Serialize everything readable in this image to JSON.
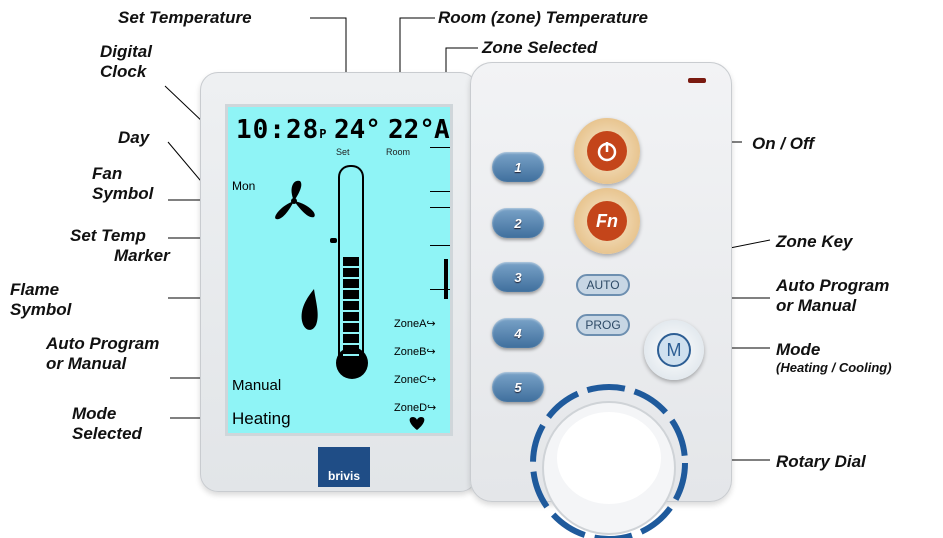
{
  "callouts": {
    "set_temperature": "Set Temperature",
    "room_temperature": "Room (zone) Temperature",
    "zone_selected": "Zone Selected",
    "digital_clock_1": "Digital",
    "digital_clock_2": "Clock",
    "day": "Day",
    "fan_symbol_1": "Fan",
    "fan_symbol_2": "Symbol",
    "set_temp_marker_1": "Set Temp",
    "set_temp_marker_2": "Marker",
    "flame_symbol_1": "Flame",
    "flame_symbol_2": "Symbol",
    "auto_program_left_1": "Auto Program",
    "auto_program_left_2": "or Manual",
    "mode_selected_1": "Mode",
    "mode_selected_2": "Selected",
    "on_off": "On / Off",
    "zone_key": "Zone Key",
    "auto_program_right_1": "Auto Program",
    "auto_program_right_2": "or Manual",
    "mode_1": "Mode",
    "mode_2": "(Heating / Cooling)",
    "rotary_dial": "Rotary Dial"
  },
  "lcd": {
    "clock": "10:28",
    "clock_suffix": "P",
    "set_temp": "24°",
    "room_temp": "22°",
    "zone": "A",
    "set_label": "Set",
    "room_label": "Room",
    "day": "Mon",
    "mode_program": "Manual",
    "mode_selected": "Heating",
    "zones": [
      "ZoneA",
      "ZoneB",
      "ZoneC",
      "ZoneD"
    ],
    "zone_arrow": "↪"
  },
  "buttons": {
    "zone_keys": [
      "1",
      "2",
      "3",
      "4",
      "5"
    ],
    "fn": "Fn",
    "auto": "AUTO",
    "prog": "PROG",
    "mode": "M"
  },
  "brand": "brivis",
  "colors": {
    "lcd_background": "#8ff4f6",
    "zone_key_blue": "#3f6f9d",
    "brand_blue": "#1f4d86",
    "dial_ring": "#1f5a9c",
    "power_ring": "#e8c590"
  }
}
